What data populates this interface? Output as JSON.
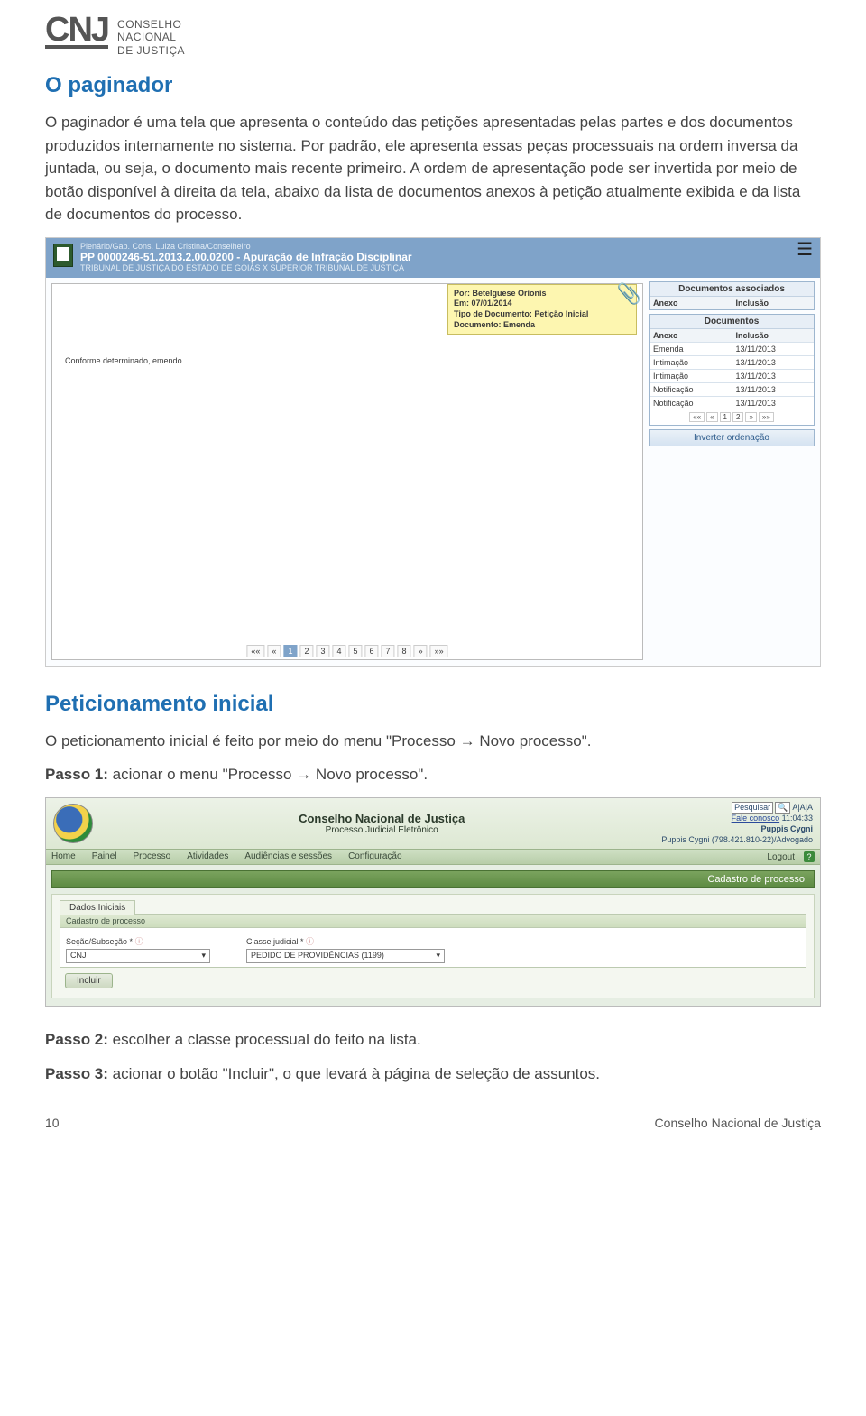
{
  "logo": {
    "mark": "CNJ",
    "line1": "CONSELHO",
    "line2": "NACIONAL",
    "line3": "DE JUSTIÇA"
  },
  "section1": {
    "title": "O paginador",
    "p1": "O paginador é uma tela que apresenta o conteúdo das petições apresentadas pelas partes e dos documentos produzidos internamente no sistema. Por padrão, ele apresenta essas peças processuais na ordem inversa da juntada, ou seja, o documento mais recente primeiro. A ordem de apresentação pode ser invertida por meio de botão disponível à direita da tela, abaixo da lista de documentos anexos à petição atualmente exibida e da lista de documentos do processo."
  },
  "shot1": {
    "crumb": "Plenário/Gab. Cons. Luiza Cristina/Conselheiro",
    "proc": "PP 0000246-51.2013.2.00.0200 - Apuração de Infração Disciplinar",
    "parties": "TRIBUNAL DE JUSTIÇA DO ESTADO DE GOIÁS X SUPERIOR TRIBUNAL DE JUSTIÇA",
    "note": {
      "l1": "Por: Betelguese Orionis",
      "l2": "Em: 07/01/2014",
      "l3": "Tipo de Documento: Petição Inicial",
      "l4": "Documento: Emenda"
    },
    "docText": "Conforme determinado, emendo.",
    "assoc": {
      "title": "Documentos associados",
      "h1": "Anexo",
      "h2": "Inclusão"
    },
    "docs": {
      "title": "Documentos",
      "h1": "Anexo",
      "h2": "Inclusão",
      "rows": [
        {
          "a": "Emenda",
          "d": "13/11/2013"
        },
        {
          "a": "Intimação",
          "d": "13/11/2013"
        },
        {
          "a": "Intimação",
          "d": "13/11/2013"
        },
        {
          "a": "Notificação",
          "d": "13/11/2013"
        },
        {
          "a": "Notificação",
          "d": "13/11/2013"
        }
      ]
    },
    "mini": {
      "b1": "««",
      "b2": "«",
      "p1": "1",
      "p2": "2",
      "b3": "»",
      "b4": "»»"
    },
    "invert": "Inverter ordenação",
    "bp": {
      "b1": "««",
      "b2": "«",
      "p1": "1",
      "p2": "2",
      "p3": "3",
      "p4": "4",
      "p5": "5",
      "p6": "6",
      "p7": "7",
      "p8": "8",
      "b3": "»",
      "b4": "»»"
    }
  },
  "section2": {
    "title": "Peticionamento inicial",
    "p1": "O peticionamento inicial é feito por meio do menu \"Processo → Novo processo\".",
    "step1b": "Passo 1:",
    "step1": " acionar o menu \"Processo → Novo processo\".",
    "step2b": "Passo 2:",
    "step2": " escolher a classe processual do feito na lista.",
    "step3b": "Passo 3:",
    "step3": " acionar o botão \"Incluir\", o que levará à página de seleção de assuntos."
  },
  "shot2": {
    "title1": "Conselho Nacional de Justiça",
    "title2": "Processo Judicial Eletrônico",
    "search": "Pesquisar",
    "fale": "Fale conosco",
    "time": "11:04:33",
    "user1": "Puppis Cygni",
    "user2": "Puppis Cygni (798.421.810-22)/Advogado",
    "menu": {
      "home": "Home",
      "painel": "Painel",
      "processo": "Processo",
      "atividades": "Atividades",
      "aud": "Audiências e sessões",
      "config": "Configuração",
      "logout": "Logout",
      "help": "?"
    },
    "cadastro": "Cadastro de processo",
    "tab": "Dados Iniciais",
    "sub": "Cadastro de processo",
    "f1label": "Seção/Subseção *",
    "f1val": "CNJ",
    "f2label": "Classe judicial *",
    "f2val": "PEDIDO DE PROVIDÊNCIAS (1199)",
    "incluir": "Incluir"
  },
  "footer": {
    "page": "10",
    "org": "Conselho Nacional de Justiça"
  }
}
